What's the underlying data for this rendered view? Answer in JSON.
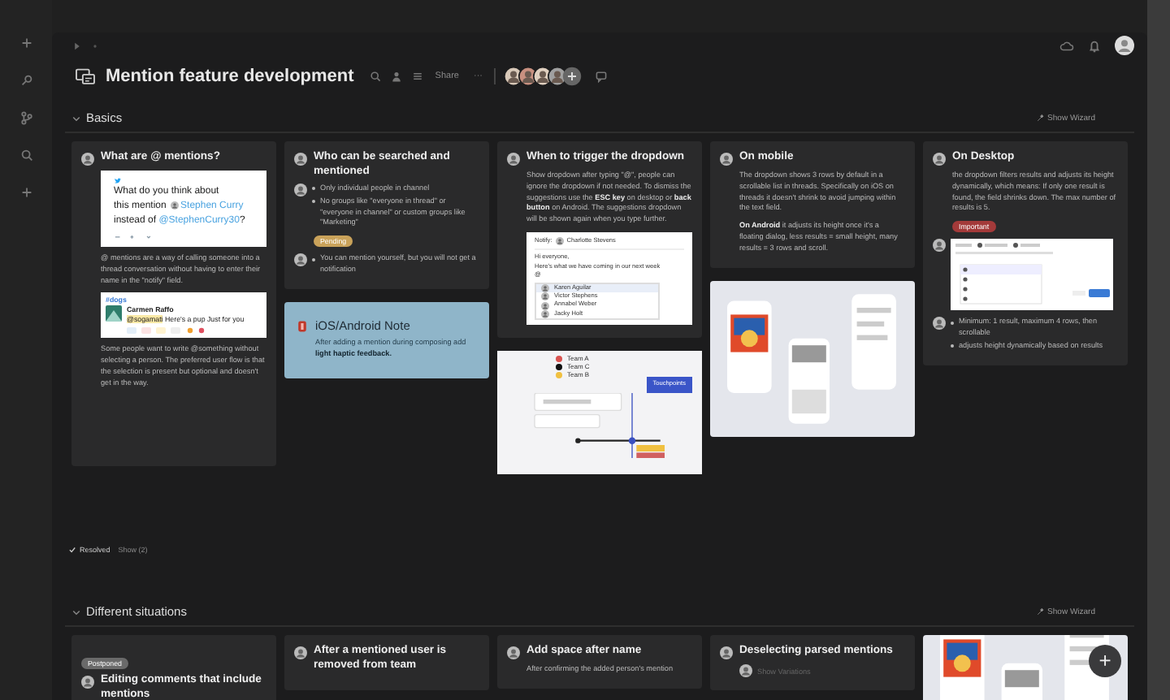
{
  "title": "Mention feature development",
  "share": "Share",
  "more": "···",
  "sections": [
    {
      "title": "Basics",
      "expanded": true,
      "wizard": "Show Wizard",
      "columns": [
        [
          {
            "kind": "card",
            "title": "What are @ mentions?",
            "blocks": [
              {
                "kind": "tweet",
                "text": "What do you think about",
                "text1": "this mention",
                "name": "Stephen Curry",
                "text2": "instead of",
                "handle": "@StephenCurry30",
                "end": "?"
              },
              {
                "kind": "para",
                "text": "@ mentions are a way of calling someone into a thread conversation without having to enter their name in the \"notify\" field."
              },
              {
                "kind": "chat",
                "channel": "#dogs",
                "author": "Carmen Raffo",
                "mention": "@sogamati",
                "text": "Here's a pup",
                "text2": "Just for you"
              },
              {
                "kind": "para",
                "text": "Some people want to write @something without selecting a person. The preferred user flow is that the selection is present but optional and doesn't get in the way."
              }
            ]
          }
        ],
        [
          {
            "kind": "card",
            "title": "Who can be searched and mentioned",
            "blocks": [
              {
                "kind": "bullets",
                "items": [
                  "Only individual people in channel",
                  "No groups like \"everyone in thread\" or \"everyone in channel\" or custom groups like \"Marketing\""
                ]
              },
              {
                "kind": "tag",
                "text": "Pending",
                "color": "#c9a25a"
              },
              {
                "kind": "bullets",
                "items": [
                  "You can mention yourself, but you will not get a notification"
                ]
              }
            ]
          },
          {
            "kind": "note",
            "title": "iOS/Android Note",
            "text": "After adding a mention during composing add **light haptic feedback.**"
          }
        ],
        [
          {
            "kind": "card",
            "title": "When to trigger the dropdown",
            "blocks": [
              {
                "kind": "para",
                "text": "Show dropdown after typing \"@\", people can ignore the dropdown if not needed. To dismiss the suggestions use the **ESC key** on desktop or **back button** on Android. The suggestions dropdown will be shown again when you type further."
              },
              {
                "kind": "composer",
                "notify": "Notify:",
                "recipient": "Charlotte Stevens",
                "greeting": "Hi everyone,",
                "body": "Here's what we have coming in our next week",
                "at": "@",
                "people": [
                  {
                    "name": "Karen Aguilar",
                    "selected": true
                  },
                  {
                    "name": "Victor Stephens",
                    "selected": false
                  },
                  {
                    "name": "Annabel Weber",
                    "selected": false
                  },
                  {
                    "name": "Jacky Holt",
                    "selected": false
                  }
                ]
              }
            ]
          },
          {
            "kind": "diagram",
            "legend": [
              {
                "label": "Team A",
                "color": "#d9534f"
              },
              {
                "label": "Team C",
                "color": "#111111"
              },
              {
                "label": "Team B",
                "color": "#f0c040"
              }
            ],
            "button": "Touchpoints"
          }
        ],
        [
          {
            "kind": "card",
            "title": "On mobile",
            "blocks": [
              {
                "kind": "para",
                "text": "The dropdown shows 3 rows by default in a scrollable list in threads. Specifically on iOS on threads it doesn't shrink to avoid jumping within the text field."
              },
              {
                "kind": "para",
                "text": "**On Android** it adjusts its height once it's a floating dialog, less results = small height, many results = 3 rows and scroll."
              }
            ]
          },
          {
            "kind": "picture"
          }
        ],
        [
          {
            "kind": "card",
            "title": "On Desktop",
            "blocks": [
              {
                "kind": "para",
                "text": "the dropdown filters results and adjusts its height dynamically, which means: If only one result is found, the field shrinks down. The max number of results is 5."
              },
              {
                "kind": "tag",
                "text": "Important",
                "color": "#a33a3a"
              },
              {
                "kind": "shot"
              },
              {
                "kind": "bullets",
                "items": [
                  "Minimum: 1 result, maximum 4 rows, then scrollable",
                  "adjusts height dynamically based on results"
                ]
              }
            ]
          }
        ]
      ],
      "resolved": {
        "label": "Resolved",
        "show": "Show (2)"
      }
    },
    {
      "title": "Different situations",
      "expanded": true,
      "wizard": "Show Wizard",
      "columns": [
        [
          {
            "kind": "card",
            "title": "Editing comments that include mentions",
            "tag": {
              "text": "Postponed",
              "color": "#6a6a6a"
            }
          }
        ],
        [
          {
            "kind": "card",
            "title": "After a mentioned user is removed from team"
          }
        ],
        [
          {
            "kind": "card",
            "title": "Add space after name",
            "blocks": [
              {
                "kind": "para",
                "text": "After confirming the added person's mention"
              }
            ]
          }
        ],
        [
          {
            "kind": "card",
            "title": "Deselecting parsed mentions",
            "blocks": [
              {
                "kind": "sub",
                "text": "Show Variations"
              }
            ]
          }
        ],
        [
          {
            "kind": "picture"
          }
        ]
      ]
    }
  ],
  "fab": "+"
}
